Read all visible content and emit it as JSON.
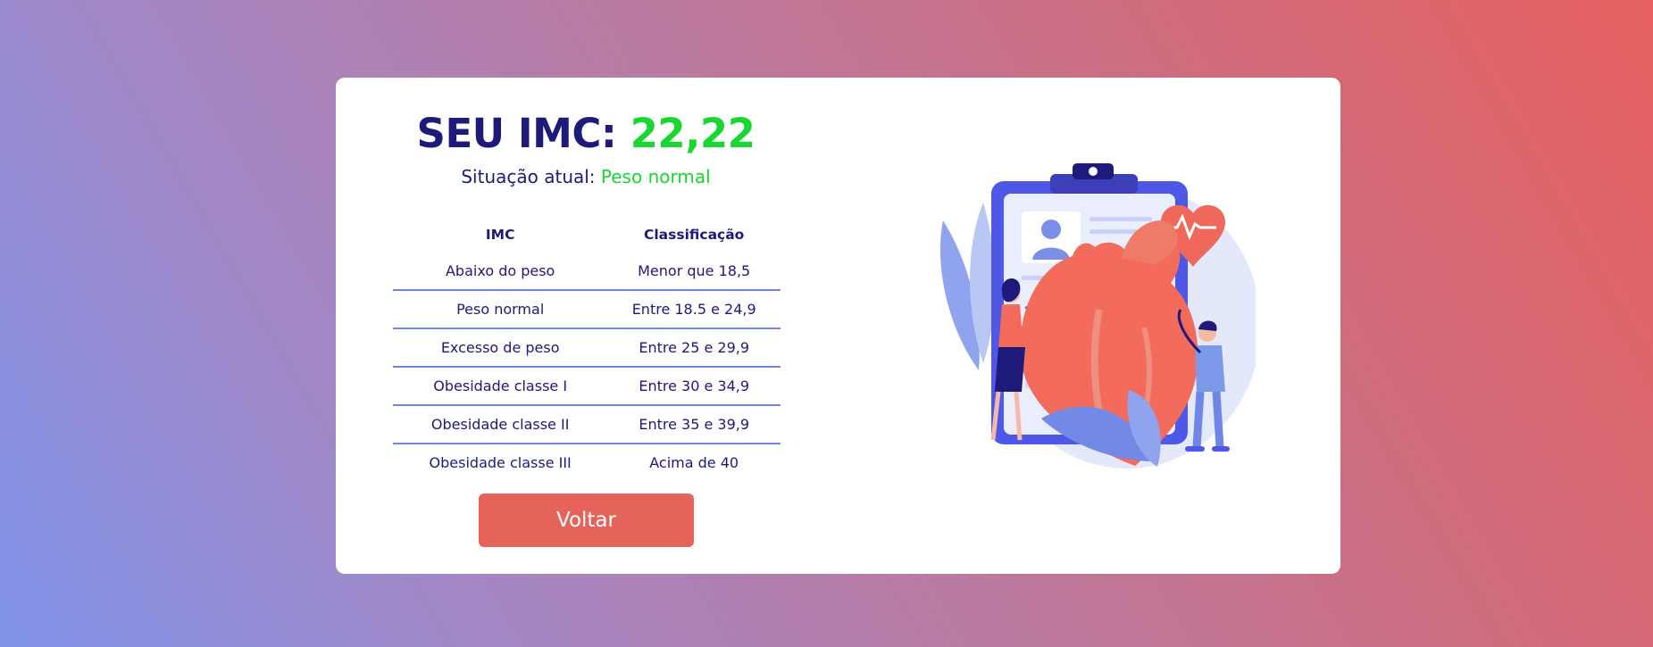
{
  "result": {
    "title_prefix": "SEU IMC:",
    "value": "22,22",
    "status_label": "Situação atual:",
    "status_value": "Peso normal"
  },
  "table": {
    "headers": [
      "IMC",
      "Classificação"
    ],
    "rows": [
      [
        "Abaixo do peso",
        "Menor que 18,5"
      ],
      [
        "Peso normal",
        "Entre 18.5 e 24,9"
      ],
      [
        "Excesso de peso",
        "Entre 25 e 29,9"
      ],
      [
        "Obesidade classe I",
        "Entre 30 e 34,9"
      ],
      [
        "Obesidade classe II",
        "Entre 35 e 39,9"
      ],
      [
        "Obesidade classe III",
        "Acima de 40"
      ]
    ]
  },
  "actions": {
    "back_label": "Voltar"
  },
  "colors": {
    "primary_text": "#1d1a7a",
    "value_green": "#1ad630",
    "button": "#e6635c",
    "divider": "#6f86e6"
  },
  "illustration": {
    "icon": "heart-checkup-illustration"
  }
}
